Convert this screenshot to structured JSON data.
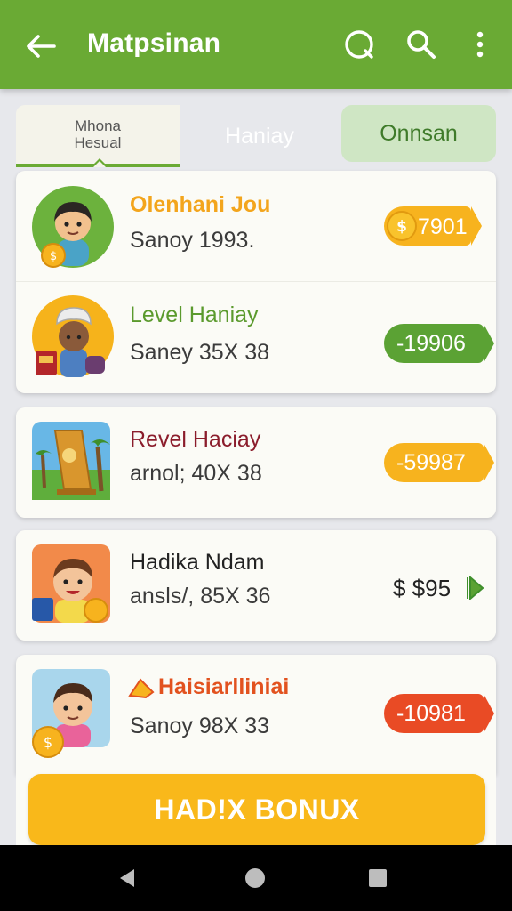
{
  "header": {
    "title": "Matpsinan",
    "icons": [
      "back-arrow-icon",
      "refresh-icon",
      "search-icon",
      "more-vert-icon"
    ],
    "color": "#6aaa34"
  },
  "tabs": [
    {
      "line1": "Mhona",
      "line2": "Hesual"
    },
    {
      "label": "Haniay"
    },
    {
      "label": "Onnsan"
    }
  ],
  "rows": [
    {
      "title": "Olenhani Jou",
      "subtitle": "Sanoy 1993.",
      "amount": "7901",
      "title_color": "#f3a51c",
      "pill_color": "#f7b31e",
      "pill_icon": "coin-icon"
    },
    {
      "title": "Level Haniay",
      "subtitle": "Saney 35X 38",
      "amount": "-19906",
      "title_color": "#5b9a2d",
      "pill_color": "#5ba234"
    },
    {
      "title": "Revel Haciay",
      "subtitle": "arnol; 40X 38",
      "amount": "-59987",
      "title_color": "#8b1d2c",
      "pill_color": "#f7b31e"
    },
    {
      "title": "Hadika Ndam",
      "subtitle": "ansls/, 85X 36",
      "amount": "$ $95",
      "title_color": "#222222",
      "pill_color": ""
    },
    {
      "title": "Haisiarlliniai",
      "subtitle": "Sanoy 98X 33",
      "amount": "-10981",
      "title_color": "#e2521f",
      "pill_color": "#e94b25"
    }
  ],
  "bonus_button": {
    "label": "HAD!X BONUX",
    "color": "#f9b81a"
  },
  "navbar": {
    "icons": [
      "nav-back-icon",
      "nav-home-icon",
      "nav-recents-icon"
    ]
  }
}
